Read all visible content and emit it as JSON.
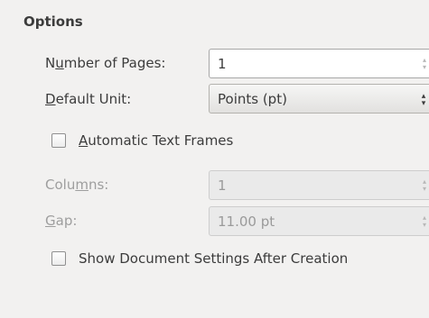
{
  "options": {
    "title": "Options",
    "pages": {
      "label_prefix": "N",
      "label_mnemonic": "u",
      "label_suffix": "mber of Pages:",
      "value": "1"
    },
    "unit": {
      "label_mnemonic": "D",
      "label_suffix": "efault Unit:",
      "value": "Points (pt)"
    },
    "auto_frames": {
      "label_mnemonic": "A",
      "label_suffix": "utomatic Text Frames",
      "checked": false
    },
    "columns": {
      "label_prefix": "Colu",
      "label_mnemonic": "m",
      "label_suffix": "ns:",
      "value": "1"
    },
    "gap": {
      "label_mnemonic": "G",
      "label_suffix": "ap:",
      "value": "11.00 pt"
    },
    "show_settings": {
      "label": "Show Document Settings After Creation",
      "checked": false
    },
    "icons": {
      "spin": "up-down-arrows-icon",
      "combo": "dropdown-arrows-icon"
    },
    "colors": {
      "background": "#f2f1f0",
      "text": "#3c3c3c",
      "disabled_text": "#9e9e9e"
    }
  }
}
